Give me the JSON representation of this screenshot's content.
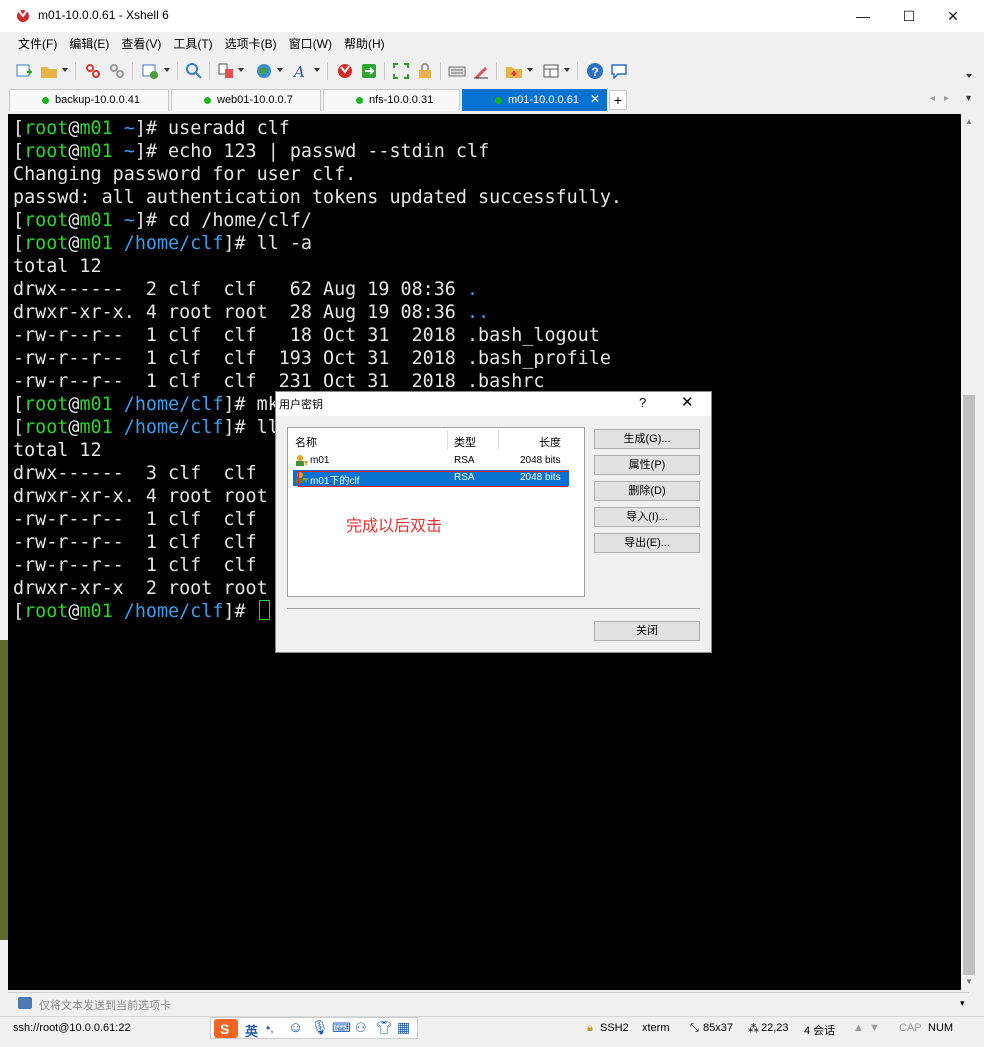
{
  "window": {
    "title": "m01-10.0.0.61 - Xshell 6",
    "min_label": "—",
    "max_label": "☐",
    "close_label": "✕"
  },
  "menu": [
    "文件(F)",
    "编辑(E)",
    "查看(V)",
    "工具(T)",
    "选项卡(B)",
    "窗口(W)",
    "帮助(H)"
  ],
  "tabs": [
    {
      "label": "backup-10.0.0.41",
      "active": false
    },
    {
      "label": "web01-10.0.0.7",
      "active": false
    },
    {
      "label": "nfs-10.0.0.31",
      "active": false
    },
    {
      "label": "m01-10.0.0.61",
      "active": true
    }
  ],
  "tab_close": "✕",
  "tab_add": "+",
  "terminal": {
    "lines": [
      [
        {
          "c": "w",
          "t": "["
        },
        {
          "c": "g",
          "t": "root"
        },
        {
          "c": "w",
          "t": "@"
        },
        {
          "c": "g",
          "t": "m01"
        },
        {
          "c": "w",
          "t": " "
        },
        {
          "c": "b",
          "t": "~"
        },
        {
          "c": "w",
          "t": "]# useradd clf"
        }
      ],
      [
        {
          "c": "w",
          "t": "["
        },
        {
          "c": "g",
          "t": "root"
        },
        {
          "c": "w",
          "t": "@"
        },
        {
          "c": "g",
          "t": "m01"
        },
        {
          "c": "w",
          "t": " "
        },
        {
          "c": "b",
          "t": "~"
        },
        {
          "c": "w",
          "t": "]# echo 123 | passwd --stdin clf"
        }
      ],
      [
        {
          "c": "w",
          "t": "Changing password for user clf."
        }
      ],
      [
        {
          "c": "w",
          "t": "passwd: all authentication tokens updated successfully."
        }
      ],
      [
        {
          "c": "w",
          "t": "["
        },
        {
          "c": "g",
          "t": "root"
        },
        {
          "c": "w",
          "t": "@"
        },
        {
          "c": "g",
          "t": "m01"
        },
        {
          "c": "w",
          "t": " "
        },
        {
          "c": "b",
          "t": "~"
        },
        {
          "c": "w",
          "t": "]# cd /home/clf/"
        }
      ],
      [
        {
          "c": "w",
          "t": "["
        },
        {
          "c": "g",
          "t": "root"
        },
        {
          "c": "w",
          "t": "@"
        },
        {
          "c": "g",
          "t": "m01"
        },
        {
          "c": "w",
          "t": " "
        },
        {
          "c": "b",
          "t": "/home/clf"
        },
        {
          "c": "w",
          "t": "]# ll -a"
        }
      ],
      [
        {
          "c": "w",
          "t": "total 12"
        }
      ],
      [
        {
          "c": "w",
          "t": "drwx------  2 clf  clf   62 Aug 19 08:36 "
        },
        {
          "c": "b",
          "t": "."
        }
      ],
      [
        {
          "c": "w",
          "t": "drwxr-xr-x. 4 root root  28 Aug 19 08:36 "
        },
        {
          "c": "b",
          "t": ".."
        }
      ],
      [
        {
          "c": "w",
          "t": "-rw-r--r--  1 clf  clf   18 Oct 31  2018 .bash_logout"
        }
      ],
      [
        {
          "c": "w",
          "t": "-rw-r--r--  1 clf  clf  193 Oct 31  2018 .bash_profile"
        }
      ],
      [
        {
          "c": "w",
          "t": "-rw-r--r--  1 clf  clf  231 Oct 31  2018 .bashrc"
        }
      ],
      [
        {
          "c": "w",
          "t": "["
        },
        {
          "c": "g",
          "t": "root"
        },
        {
          "c": "w",
          "t": "@"
        },
        {
          "c": "g",
          "t": "m01"
        },
        {
          "c": "w",
          "t": " "
        },
        {
          "c": "b",
          "t": "/home/clf"
        },
        {
          "c": "w",
          "t": "]# mk"
        }
      ],
      [
        {
          "c": "w",
          "t": "["
        },
        {
          "c": "g",
          "t": "root"
        },
        {
          "c": "w",
          "t": "@"
        },
        {
          "c": "g",
          "t": "m01"
        },
        {
          "c": "w",
          "t": " "
        },
        {
          "c": "b",
          "t": "/home/clf"
        },
        {
          "c": "w",
          "t": "]# ll"
        }
      ],
      [
        {
          "c": "w",
          "t": "total 12"
        }
      ],
      [
        {
          "c": "w",
          "t": "drwx------  3 clf  clf"
        }
      ],
      [
        {
          "c": "w",
          "t": "drwxr-xr-x. 4 root root"
        }
      ],
      [
        {
          "c": "w",
          "t": "-rw-r--r--  1 clf  clf"
        }
      ],
      [
        {
          "c": "w",
          "t": "-rw-r--r--  1 clf  clf"
        }
      ],
      [
        {
          "c": "w",
          "t": "-rw-r--r--  1 clf  clf"
        }
      ],
      [
        {
          "c": "w",
          "t": "drwxr-xr-x  2 root root"
        }
      ],
      [
        {
          "c": "w",
          "t": "["
        },
        {
          "c": "g",
          "t": "root"
        },
        {
          "c": "w",
          "t": "@"
        },
        {
          "c": "g",
          "t": "m01"
        },
        {
          "c": "w",
          "t": " "
        },
        {
          "c": "b",
          "t": "/home/clf"
        },
        {
          "c": "w",
          "t": "]# "
        }
      ]
    ]
  },
  "sendbar": {
    "placeholder": "仅将文本发送到当前选项卡"
  },
  "status": {
    "connection": "ssh://root@10.0.0.61:22",
    "protocol": "SSH2",
    "term": "xterm",
    "size": "85x37",
    "position": "22,23",
    "sessions": "4 会话",
    "cap": "CAP",
    "num": "NUM"
  },
  "ime": {
    "lang": "英",
    "punct": "•,"
  },
  "dialog": {
    "title": "用户密钥",
    "help": "?",
    "close": "✕",
    "columns": {
      "name": "名称",
      "type": "类型",
      "length": "长度"
    },
    "keys": [
      {
        "name": "m01",
        "type": "RSA",
        "length": "2048 bits",
        "selected": false
      },
      {
        "name": "m01下的clf",
        "type": "RSA",
        "length": "2048 bits",
        "selected": true
      }
    ],
    "annotation": "完成以后双击",
    "buttons": {
      "generate": "生成(G)...",
      "properties": "属性(P)",
      "delete": "删除(D)",
      "import": "导入(I)...",
      "export": "导出(E)...",
      "close": "关闭"
    }
  },
  "colors": {
    "accent": "#0a72d0",
    "prompt_green": "#2dd52d",
    "path_blue": "#3aa0f0",
    "annotation_red": "#e53333"
  }
}
